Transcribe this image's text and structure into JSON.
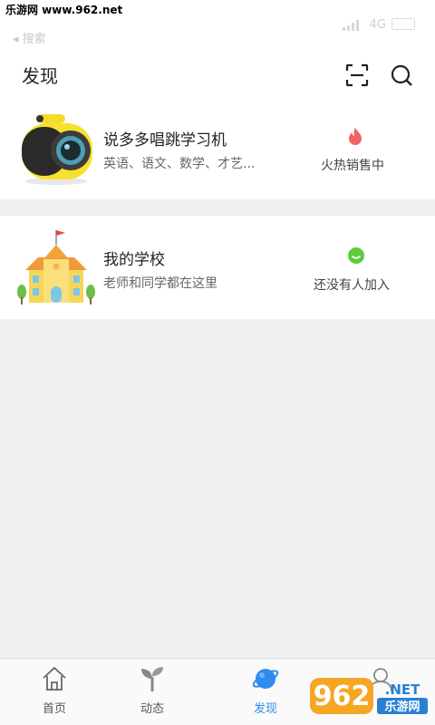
{
  "status_bar": {
    "watermark": "乐游网 www.962.net",
    "back_label": "◂ 搜索",
    "network": "4G"
  },
  "header": {
    "title": "发现",
    "scan_icon": "scan-icon",
    "search_icon": "search-icon"
  },
  "cards": [
    {
      "title": "说多多唱跳学习机",
      "subtitle": "英语、语文、数学、才艺...",
      "status": "火热销售中",
      "status_icon": "fire-icon",
      "status_color": "#f06262"
    },
    {
      "title": "我的学校",
      "subtitle": "老师和同学都在这里",
      "status": "还没有人加入",
      "status_icon": "smile-icon",
      "status_color": "#5ccc3c"
    }
  ],
  "tabbar": {
    "tabs": [
      {
        "label": "首页",
        "icon": "home-icon",
        "active": false
      },
      {
        "label": "动态",
        "icon": "sprout-icon",
        "active": false
      },
      {
        "label": "发现",
        "icon": "planet-icon",
        "active": true
      },
      {
        "label": "",
        "icon": "profile-icon",
        "active": false
      }
    ],
    "active_color": "#2e8cf0"
  },
  "watermark_logo": {
    "number": "962",
    "suffix": ".NET",
    "chinese": "乐游网"
  }
}
